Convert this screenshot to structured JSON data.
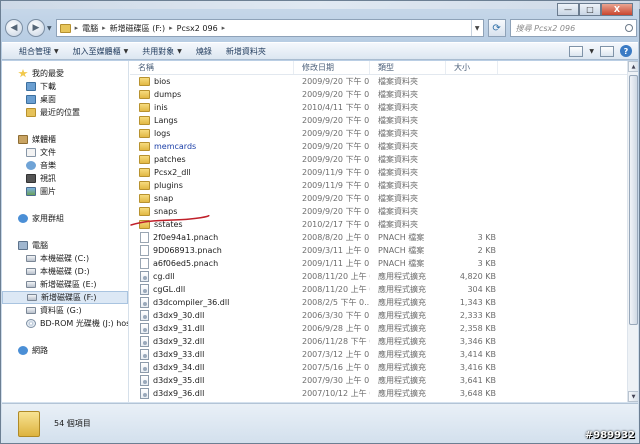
{
  "window": {
    "minimize": "—",
    "maximize": "□",
    "close": "X"
  },
  "address": {
    "crumbs": [
      "電腦",
      "新增磁碟區 (F:)",
      "Pcsx2 096"
    ],
    "search_placeholder": "搜尋 Pcsx2 096"
  },
  "toolbar": {
    "organize": "組合管理",
    "include": "加入至媒體櫃",
    "share": "共用對象",
    "burn": "燒錄",
    "new_folder": "新增資料夾"
  },
  "sidebar": {
    "favorites": {
      "title": "我的最愛",
      "items": [
        "下載",
        "桌面",
        "最近的位置"
      ]
    },
    "libraries": {
      "title": "媒體櫃",
      "items": [
        "文件",
        "音樂",
        "視訊",
        "圖片"
      ]
    },
    "homegroup": "家用群組",
    "computer": {
      "title": "電腦",
      "items": [
        "本機磁碟 (C:)",
        "本機磁碟 (D:)",
        "新增磁碟區 (E:)",
        "新增磁碟區 (F:)",
        "資料區 (G:)",
        "BD-ROM 光碟機 (J:) hoshi"
      ]
    },
    "network": "網路"
  },
  "columns": {
    "name": "名稱",
    "date": "修改日期",
    "type": "類型",
    "size": "大小"
  },
  "files": [
    {
      "name": "bios",
      "date": "2009/9/20 下午 0...",
      "type": "檔案資料夾",
      "size": "",
      "kind": "folder"
    },
    {
      "name": "dumps",
      "date": "2009/9/20 下午 0...",
      "type": "檔案資料夾",
      "size": "",
      "kind": "folder"
    },
    {
      "name": "inis",
      "date": "2010/4/11 下午 0...",
      "type": "檔案資料夾",
      "size": "",
      "kind": "folder"
    },
    {
      "name": "Langs",
      "date": "2009/9/20 下午 0...",
      "type": "檔案資料夾",
      "size": "",
      "kind": "folder"
    },
    {
      "name": "logs",
      "date": "2009/9/20 下午 0...",
      "type": "檔案資料夾",
      "size": "",
      "kind": "folder"
    },
    {
      "name": "memcards",
      "date": "2009/9/20 下午 0...",
      "type": "檔案資料夾",
      "size": "",
      "kind": "folder"
    },
    {
      "name": "patches",
      "date": "2009/9/20 下午 0...",
      "type": "檔案資料夾",
      "size": "",
      "kind": "folder"
    },
    {
      "name": "Pcsx2_dll",
      "date": "2009/11/9 下午 0...",
      "type": "檔案資料夾",
      "size": "",
      "kind": "folder"
    },
    {
      "name": "plugins",
      "date": "2009/11/9 下午 0...",
      "type": "檔案資料夾",
      "size": "",
      "kind": "folder"
    },
    {
      "name": "snap",
      "date": "2009/9/20 下午 0...",
      "type": "檔案資料夾",
      "size": "",
      "kind": "folder"
    },
    {
      "name": "snaps",
      "date": "2009/9/20 下午 0...",
      "type": "檔案資料夾",
      "size": "",
      "kind": "folder"
    },
    {
      "name": "sstates",
      "date": "2010/2/17 下午 0...",
      "type": "檔案資料夾",
      "size": "",
      "kind": "folder"
    },
    {
      "name": "2f0e94a1.pnach",
      "date": "2008/8/20 上午 0...",
      "type": "PNACH 檔案",
      "size": "3 KB",
      "kind": "file"
    },
    {
      "name": "9D068913.pnach",
      "date": "2009/3/11 上午 0...",
      "type": "PNACH 檔案",
      "size": "2 KB",
      "kind": "file"
    },
    {
      "name": "a6f06ed5.pnach",
      "date": "2009/1/11 上午 0...",
      "type": "PNACH 檔案",
      "size": "3 KB",
      "kind": "file"
    },
    {
      "name": "cg.dll",
      "date": "2008/11/20 上午 0...",
      "type": "應用程式擴充",
      "size": "4,820 KB",
      "kind": "dll"
    },
    {
      "name": "cgGL.dll",
      "date": "2008/11/20 上午 0...",
      "type": "應用程式擴充",
      "size": "304 KB",
      "kind": "dll"
    },
    {
      "name": "d3dcompiler_36.dll",
      "date": "2008/2/5 下午 0...",
      "type": "應用程式擴充",
      "size": "1,343 KB",
      "kind": "dll"
    },
    {
      "name": "d3dx9_30.dll",
      "date": "2006/3/30 下午 0...",
      "type": "應用程式擴充",
      "size": "2,333 KB",
      "kind": "dll"
    },
    {
      "name": "d3dx9_31.dll",
      "date": "2006/9/28 上午 0...",
      "type": "應用程式擴充",
      "size": "2,358 KB",
      "kind": "dll"
    },
    {
      "name": "d3dx9_32.dll",
      "date": "2006/11/28 下午 0...",
      "type": "應用程式擴充",
      "size": "3,346 KB",
      "kind": "dll"
    },
    {
      "name": "d3dx9_33.dll",
      "date": "2007/3/12 上午 0...",
      "type": "應用程式擴充",
      "size": "3,414 KB",
      "kind": "dll"
    },
    {
      "name": "d3dx9_34.dll",
      "date": "2007/5/16 上午 0...",
      "type": "應用程式擴充",
      "size": "3,416 KB",
      "kind": "dll"
    },
    {
      "name": "d3dx9_35.dll",
      "date": "2007/9/30 上午 0...",
      "type": "應用程式擴充",
      "size": "3,641 KB",
      "kind": "dll"
    },
    {
      "name": "d3dx9_36.dll",
      "date": "2007/10/12 上午 0...",
      "type": "應用程式擴充",
      "size": "3,648 KB",
      "kind": "dll"
    }
  ],
  "status": {
    "count": "54 個項目"
  },
  "watermark": "#989932",
  "colors": {
    "accent": "#1b3fa8",
    "scribble": "#c0202a"
  }
}
